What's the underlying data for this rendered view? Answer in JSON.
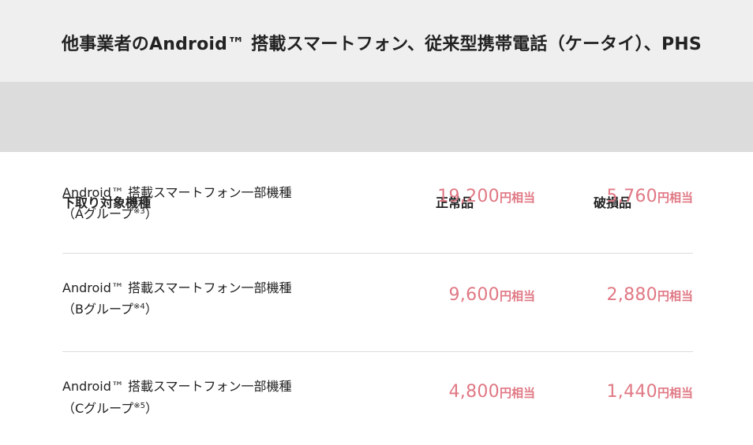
{
  "title": "他事業者のAndroid™ 搭載スマートフォン、従来型携帯電話（ケータイ）、PHS",
  "header": {
    "model": "下取り対象機種",
    "normal": "正常品",
    "damaged": "破損品"
  },
  "rows": [
    {
      "name_line1": "Android™ 搭載スマートフォン一部機種",
      "name_group": "（Aグループ",
      "name_note": "※3",
      "name_close": "）",
      "normal_value": "19,200",
      "normal_unit": "円相当",
      "damaged_value": "5,760",
      "damaged_unit": "円相当"
    },
    {
      "name_line1": "Android™ 搭載スマートフォン一部機種",
      "name_group": "（Bグループ",
      "name_note": "※4",
      "name_close": "）",
      "normal_value": "9,600",
      "normal_unit": "円相当",
      "damaged_value": "2,880",
      "damaged_unit": "円相当"
    },
    {
      "name_line1": "Android™ 搭載スマートフォン一部機種",
      "name_group": "（Cグループ",
      "name_note": "※5",
      "name_close": "）",
      "normal_value": "4,800",
      "normal_unit": "円相当",
      "damaged_value": "1,440",
      "damaged_unit": "円相当"
    }
  ],
  "colors": {
    "price": "#e07884",
    "title_band": "#efefef",
    "header_band": "#dcdcdc",
    "divider": "#dcdcdc"
  }
}
